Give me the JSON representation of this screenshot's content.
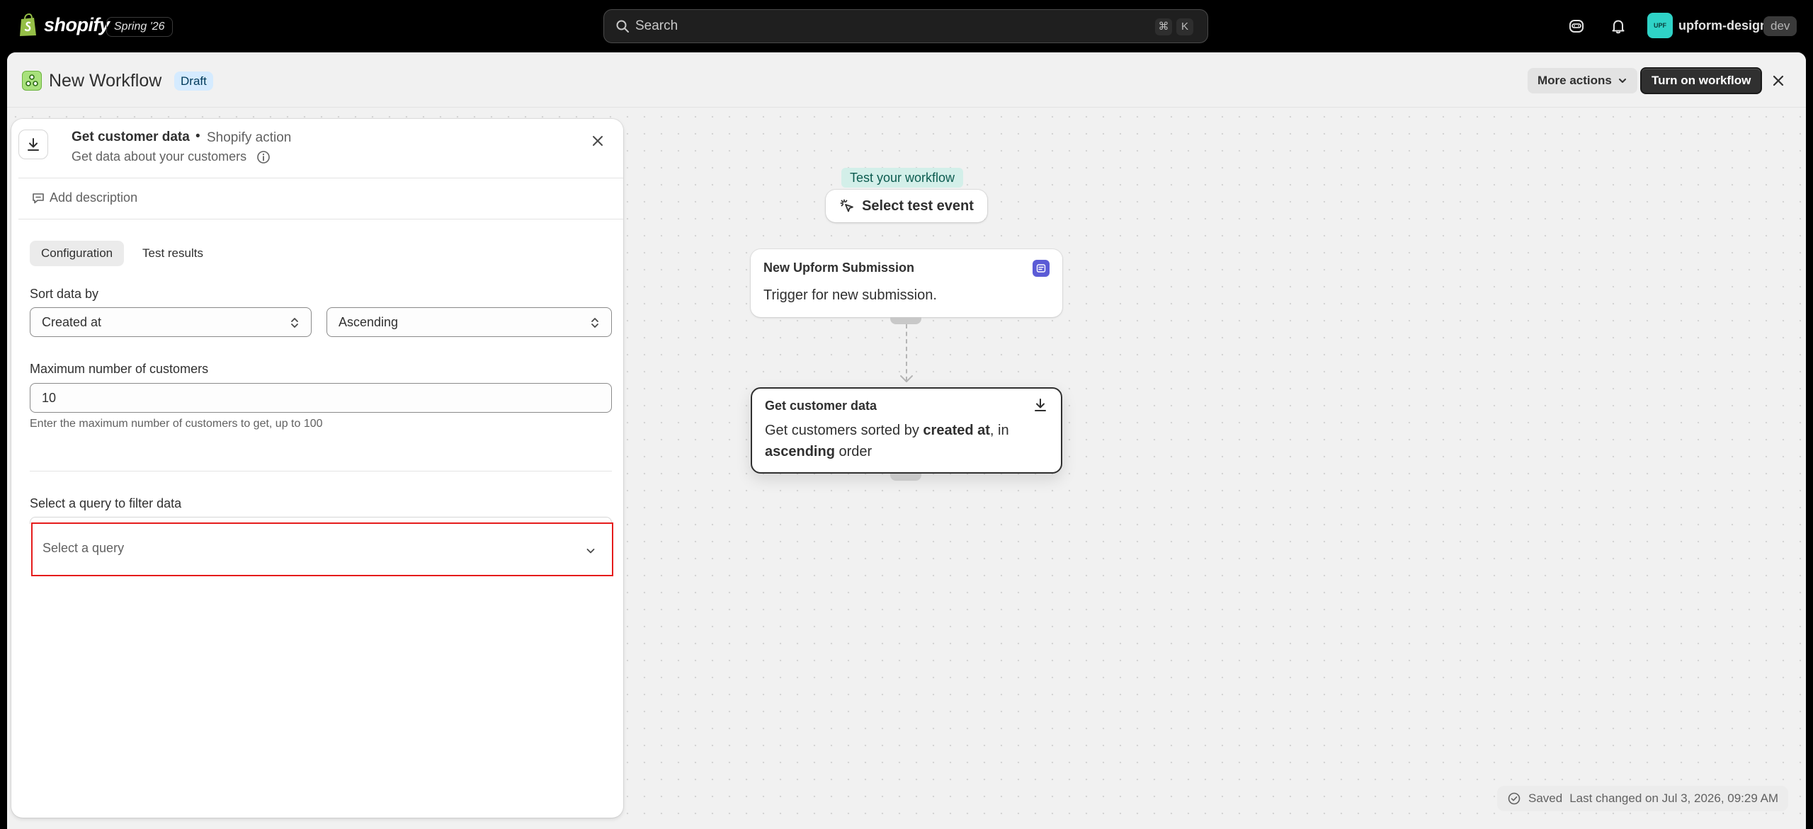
{
  "topbar": {
    "logo_text": "shopify",
    "version": "Spring '26",
    "search_placeholder": "Search",
    "shortcut_mod": "⌘",
    "shortcut_key": "K",
    "avatar_initials": "UPF",
    "store_name": "upform-design",
    "env_badge": "dev"
  },
  "header": {
    "title": "New Workflow",
    "status": "Draft",
    "more_actions": "More actions",
    "primary_action": "Turn on workflow"
  },
  "panel": {
    "title": "Get customer data",
    "separator": "•",
    "kind": "Shopify action",
    "subtitle": "Get data about your customers",
    "add_description": "Add description",
    "tabs": [
      {
        "label": "Configuration",
        "active": true
      },
      {
        "label": "Test results",
        "active": false
      }
    ],
    "sort_label": "Sort data by",
    "sort_field": "Created at",
    "sort_order": "Ascending",
    "max_label": "Maximum number of customers",
    "max_value": "10",
    "max_help": "Enter the maximum number of customers to get, up to 100",
    "query_label": "Select a query to filter data",
    "query_placeholder": "Select a query"
  },
  "workflow": {
    "test_label": "Test your workflow",
    "test_button": "Select test event",
    "trigger": {
      "title": "New Upform Submission",
      "body": "Trigger for new submission."
    },
    "action": {
      "title": "Get customer data",
      "body_1": "Get customers sorted by ",
      "body_bold_1": "created at",
      "body_2": ", in ",
      "body_bold_2": "ascending",
      "body_3": " order"
    }
  },
  "status": {
    "saved": "Saved",
    "last_changed": "Last changed on Jul 3, 2026, 09:29 AM"
  },
  "colors": {
    "accent_dark": "#303030",
    "draft_bg": "#d5ebff",
    "error_border": "#e51c1c",
    "avatar_bg": "#2fd3c7",
    "test_label_bg": "#d3efe9"
  }
}
